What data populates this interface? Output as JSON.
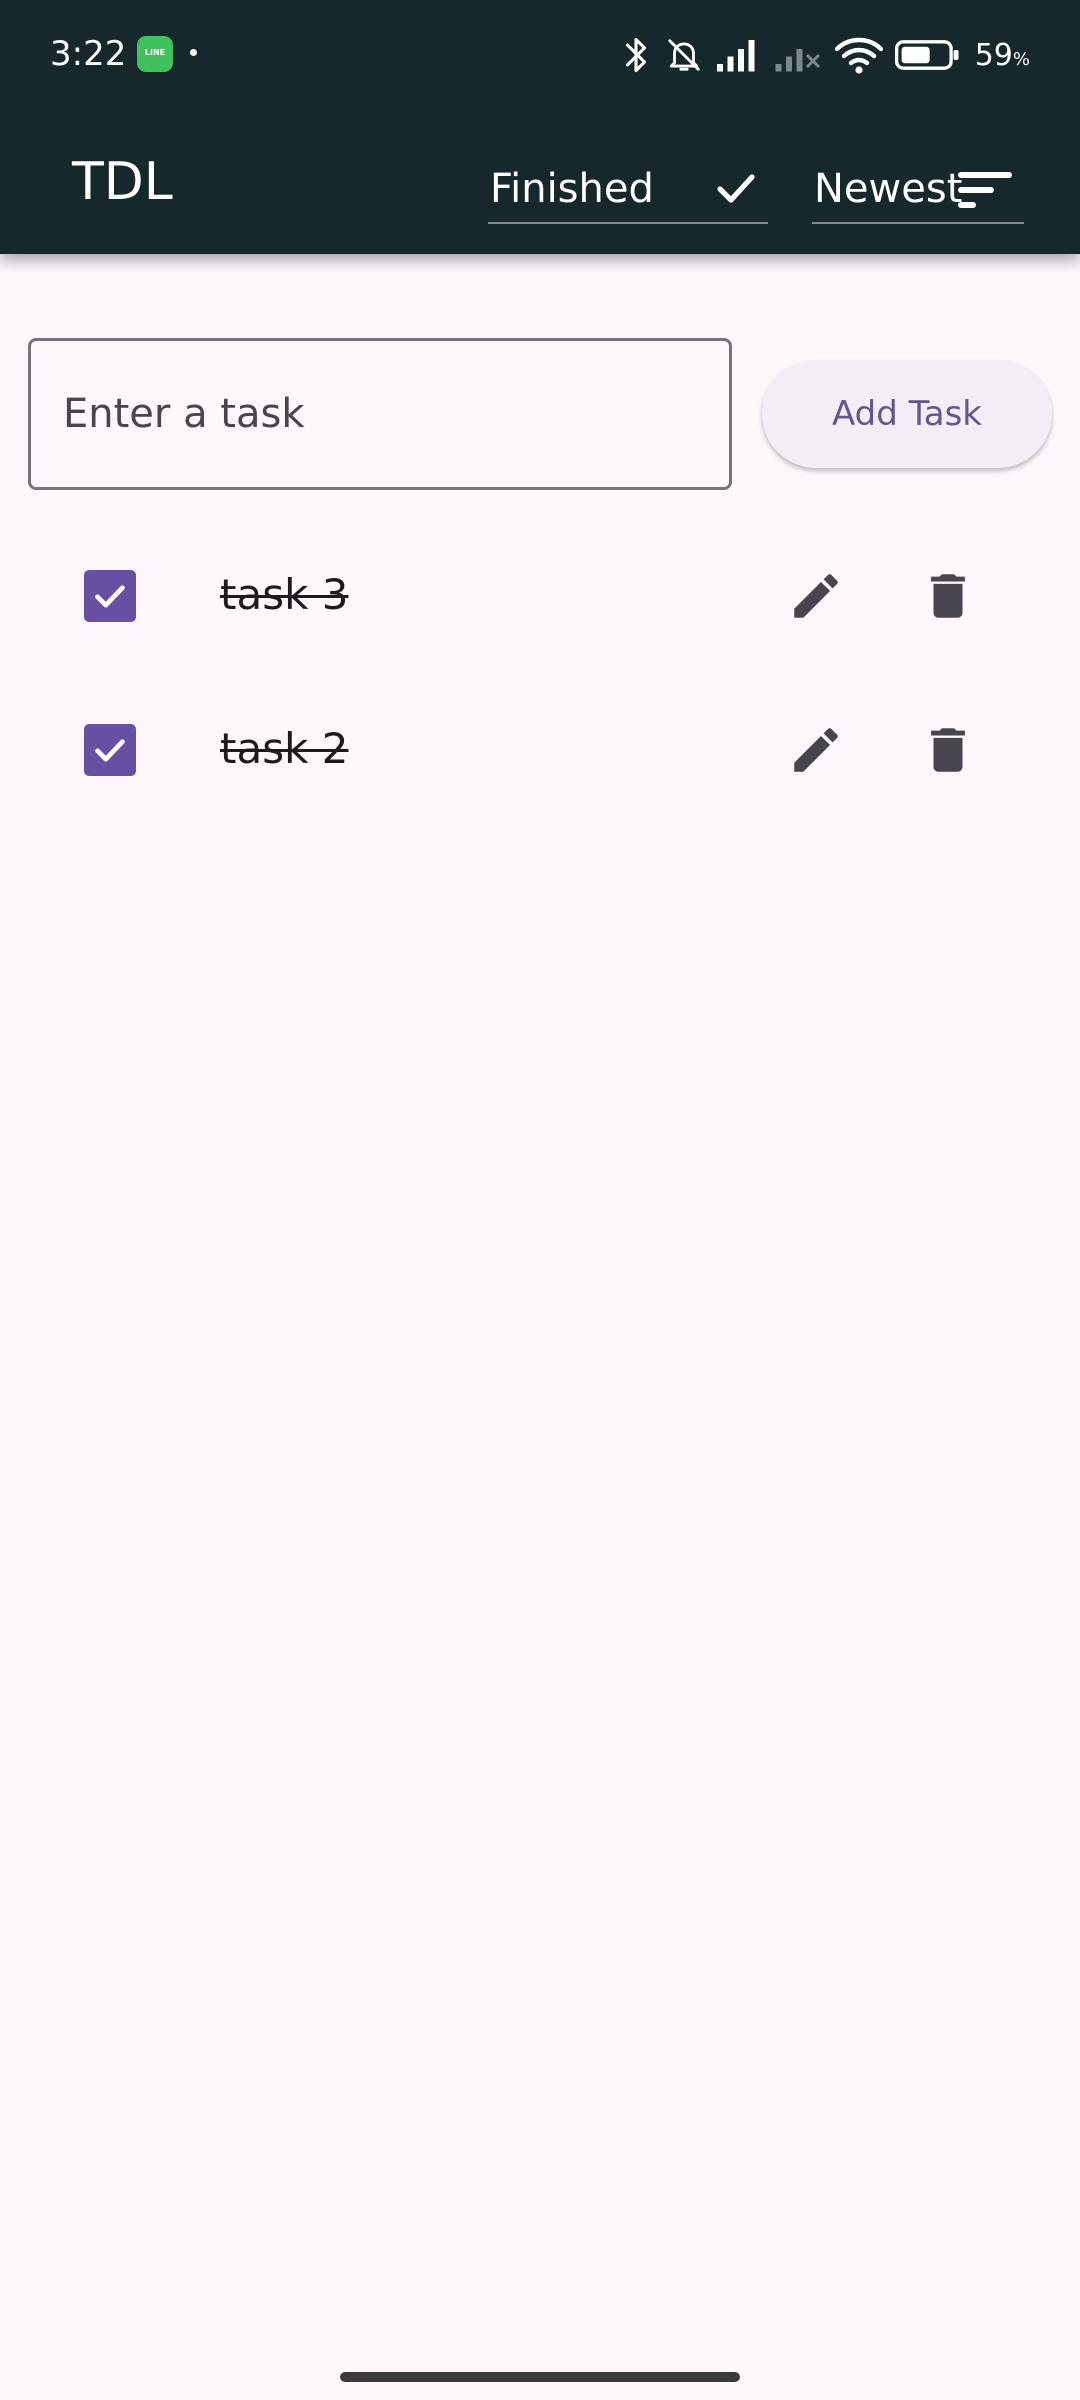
{
  "status_bar": {
    "time": "3:22",
    "line_app_label": "LINE",
    "battery_percent": "59",
    "battery_unit": "%",
    "icons": [
      "line-icon",
      "bluetooth-icon",
      "bell-off-icon",
      "signal-icon",
      "signal-off-icon",
      "wifi-icon",
      "battery-icon"
    ]
  },
  "app_bar": {
    "title": "TDL",
    "filter_label": "Finished",
    "filter_icon": "check-icon",
    "sort_label": "Newest",
    "sort_icon": "sort-icon"
  },
  "input": {
    "placeholder": "Enter a task",
    "value": ""
  },
  "add_button": {
    "label": "Add Task"
  },
  "tasks": [
    {
      "text": "task 3",
      "done": true
    },
    {
      "text": "task 2",
      "done": true
    }
  ],
  "colors": {
    "app_bar": "#16282b",
    "background": "#fdf7fc",
    "accent": "#6750a4",
    "button_bg": "#f4edf6",
    "button_text": "#65558f",
    "icon": "#49454f"
  }
}
